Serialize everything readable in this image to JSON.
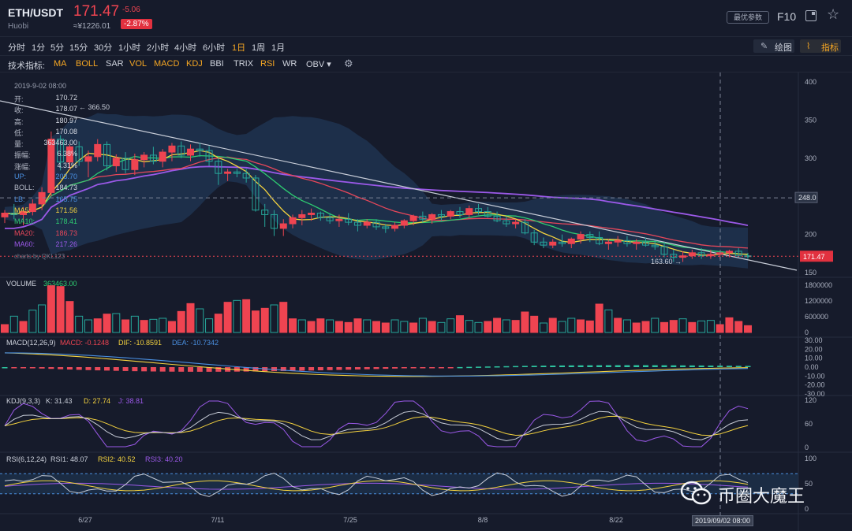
{
  "header": {
    "pair": "ETH/USDT",
    "exchange": "Huobi",
    "price": "171.47",
    "change": "-5.06",
    "cny_price": "≈¥1226.01",
    "change_pct": "-2.87%",
    "opt_button": "最优参数",
    "f10": "F10"
  },
  "timeframes": [
    "分时",
    "1分",
    "5分",
    "15分",
    "30分",
    "1小时",
    "2小时",
    "4小时",
    "6小时",
    "1日",
    "1周",
    "1月"
  ],
  "active_timeframe": "1日",
  "toolbar": {
    "draw_label": "绘图",
    "indicator_label": "指标"
  },
  "indicators": {
    "label": "技术指标:",
    "items": [
      {
        "name": "MA",
        "color": "#f5a623"
      },
      {
        "name": "BOLL",
        "color": "#f5a623"
      },
      {
        "name": "SAR",
        "color": "#d0d4de"
      },
      {
        "name": "VOL",
        "color": "#f5a623"
      },
      {
        "name": "MACD",
        "color": "#f5a623"
      },
      {
        "name": "KDJ",
        "color": "#f5a623"
      },
      {
        "name": "BBI",
        "color": "#d0d4de"
      },
      {
        "name": "TRIX",
        "color": "#d0d4de"
      },
      {
        "name": "RSI",
        "color": "#f5a623"
      },
      {
        "name": "WR",
        "color": "#d0d4de"
      },
      {
        "name": "OBV ▾",
        "color": "#d0d4de"
      }
    ]
  },
  "info_panel": {
    "date": "2019-9-02 08:00",
    "rows": [
      {
        "k": "开:",
        "v": "170.72",
        "kc": "#b6bbc8"
      },
      {
        "k": "收:",
        "v": "178.07",
        "kc": "#b6bbc8"
      },
      {
        "k": "高:",
        "v": "180.97",
        "kc": "#b6bbc8"
      },
      {
        "k": "低:",
        "v": "170.08",
        "kc": "#b6bbc8"
      },
      {
        "k": "量:",
        "v": "363463.00",
        "kc": "#b6bbc8"
      },
      {
        "k": "振幅:",
        "v": "6.38%",
        "kc": "#b6bbc8"
      },
      {
        "k": "涨幅:",
        "v": "4.31%",
        "kc": "#b6bbc8"
      },
      {
        "k": "UP:",
        "v": "203.70",
        "kc": "#4a90e2"
      },
      {
        "k": "BOLL:",
        "v": "184.73",
        "kc": "#b6bbc8"
      },
      {
        "k": "LB:",
        "v": "165.75",
        "kc": "#4a90e2"
      },
      {
        "k": "MA5:",
        "v": "171.56",
        "kc": "#f5d33f"
      },
      {
        "k": "MA10:",
        "v": "178.41",
        "kc": "#2ecc71"
      },
      {
        "k": "MA20:",
        "v": "186.73",
        "kc": "#e8475a"
      },
      {
        "k": "MA60:",
        "v": "217.26",
        "kc": "#9b59e8"
      }
    ],
    "credit": "charts by QKL123"
  },
  "price_axis": [
    "400",
    "350",
    "300",
    "250",
    "200",
    "150"
  ],
  "price_tags": {
    "current": "171.47",
    "cross": "248.0",
    "low": "163.60",
    "high": "366.50"
  },
  "volume": {
    "label": "VOLUME",
    "value": "363463.00",
    "axis": [
      "1800000",
      "1200000",
      "600000",
      "0"
    ]
  },
  "macd": {
    "label": "MACD(12,26,9)",
    "macd": "MACD: -0.1248",
    "dif": "DIF: -10.8591",
    "dea": "DEA: -10.7342",
    "axis": [
      "30.00",
      "20.00",
      "10.00",
      "0.00",
      "-10.00",
      "-20.00",
      "-30.00"
    ]
  },
  "kdj": {
    "label": "KDJ(9,3,3)",
    "k": "K: 31.43",
    "d": "D: 27.74",
    "j": "J: 38.81",
    "axis": [
      "120",
      "60",
      "0"
    ]
  },
  "rsi": {
    "label": "RSI(6,12,24)",
    "r1": "RSI1: 48.07",
    "r2": "RSI2: 40.52",
    "r3": "RSI3: 40.20",
    "axis": [
      "100",
      "50",
      "0"
    ]
  },
  "x_axis": [
    "6/27",
    "7/11",
    "7/25",
    "8/8",
    "8/22"
  ],
  "cross_date": "2019/09/02 08:00",
  "watermark": "币圈大魔王",
  "colors": {
    "up": "#ef4451",
    "down": "#26a69a",
    "ma5": "#f5d33f",
    "ma10": "#2ecc71",
    "ma20": "#e8475a",
    "ma60": "#9b59e8",
    "bg": "#161b2b"
  },
  "candles": [
    [
      223,
      232,
      215,
      228
    ],
    [
      228,
      240,
      220,
      226
    ],
    [
      226,
      236,
      212,
      230
    ],
    [
      230,
      246,
      225,
      240
    ],
    [
      240,
      262,
      232,
      255
    ],
    [
      255,
      335,
      250,
      325
    ],
    [
      325,
      330,
      284,
      295
    ],
    [
      295,
      318,
      285,
      315
    ],
    [
      315,
      322,
      290,
      296
    ],
    [
      296,
      310,
      275,
      302
    ],
    [
      302,
      325,
      296,
      318
    ],
    [
      318,
      322,
      284,
      290
    ],
    [
      290,
      305,
      282,
      300
    ],
    [
      300,
      308,
      280,
      285
    ],
    [
      285,
      306,
      278,
      298
    ],
    [
      298,
      308,
      288,
      304
    ],
    [
      304,
      315,
      292,
      296
    ],
    [
      296,
      312,
      288,
      308
    ],
    [
      308,
      320,
      296,
      316
    ],
    [
      316,
      322,
      300,
      304
    ],
    [
      304,
      318,
      296,
      312
    ],
    [
      312,
      320,
      302,
      310
    ],
    [
      310,
      316,
      290,
      296
    ],
    [
      296,
      300,
      265,
      280
    ],
    [
      280,
      286,
      270,
      282
    ],
    [
      282,
      286,
      275,
      280
    ],
    [
      280,
      286,
      268,
      274
    ],
    [
      274,
      278,
      230,
      232
    ],
    [
      232,
      240,
      210,
      226
    ],
    [
      226,
      232,
      198,
      208
    ],
    [
      208,
      220,
      198,
      214
    ],
    [
      214,
      226,
      208,
      222
    ],
    [
      222,
      232,
      212,
      226
    ],
    [
      226,
      234,
      218,
      228
    ],
    [
      228,
      230,
      218,
      222
    ],
    [
      222,
      228,
      214,
      218
    ],
    [
      218,
      226,
      210,
      220
    ],
    [
      220,
      228,
      212,
      216
    ],
    [
      216,
      220,
      204,
      212
    ],
    [
      212,
      220,
      208,
      216
    ],
    [
      216,
      220,
      206,
      210
    ],
    [
      210,
      214,
      202,
      208
    ],
    [
      208,
      216,
      204,
      212
    ],
    [
      212,
      220,
      208,
      218
    ],
    [
      218,
      226,
      212,
      224
    ],
    [
      224,
      230,
      216,
      220
    ],
    [
      220,
      228,
      214,
      226
    ],
    [
      226,
      232,
      218,
      224
    ],
    [
      224,
      232,
      220,
      230
    ],
    [
      230,
      236,
      222,
      226
    ],
    [
      226,
      238,
      222,
      234
    ],
    [
      234,
      240,
      226,
      230
    ],
    [
      230,
      236,
      222,
      224
    ],
    [
      224,
      230,
      216,
      218
    ],
    [
      218,
      224,
      210,
      214
    ],
    [
      214,
      220,
      208,
      216
    ],
    [
      216,
      220,
      200,
      202
    ],
    [
      202,
      206,
      186,
      190
    ],
    [
      190,
      196,
      182,
      186
    ],
    [
      186,
      194,
      182,
      190
    ],
    [
      190,
      200,
      184,
      188
    ],
    [
      188,
      196,
      182,
      194
    ],
    [
      194,
      204,
      188,
      200
    ],
    [
      200,
      204,
      190,
      196
    ],
    [
      196,
      204,
      186,
      188
    ],
    [
      188,
      194,
      180,
      190
    ],
    [
      190,
      198,
      184,
      192
    ],
    [
      192,
      198,
      184,
      188
    ],
    [
      188,
      194,
      180,
      190
    ],
    [
      190,
      196,
      184,
      186
    ],
    [
      186,
      192,
      180,
      184
    ],
    [
      184,
      190,
      170,
      174
    ],
    [
      174,
      180,
      164,
      170
    ],
    [
      170,
      178,
      164,
      172
    ],
    [
      172,
      180,
      168,
      176
    ],
    [
      176,
      182,
      168,
      172
    ],
    [
      172,
      180,
      168,
      174
    ],
    [
      174,
      178,
      168,
      176
    ],
    [
      176,
      180,
      170,
      178
    ],
    [
      178,
      182,
      170,
      172
    ],
    [
      172,
      176,
      168,
      171
    ]
  ],
  "volumes": [
    300000,
    620000,
    420000,
    850000,
    1050000,
    1780000,
    1750000,
    1180000,
    620000,
    480000,
    520000,
    700000,
    720000,
    480000,
    620000,
    460000,
    500000,
    540000,
    420000,
    800000,
    1100000,
    900000,
    520000,
    700000,
    1150000,
    1220000,
    1250000,
    820000,
    920000,
    1050000,
    1150000,
    520000,
    480000,
    420000,
    520000,
    480000,
    420000,
    380000,
    520000,
    480000,
    420000,
    360000,
    480000,
    420000,
    360000,
    540000,
    420000,
    380000,
    520000,
    640000,
    460000,
    380000,
    420000,
    540000,
    480000,
    460000,
    780000,
    620000,
    360000,
    540000,
    420000,
    540000,
    480000,
    440000,
    1080000,
    860000,
    540000,
    480000,
    360000,
    420000,
    540000,
    380000,
    460000,
    520000,
    380000,
    440000,
    460000,
    300000,
    560000,
    420000,
    260000
  ],
  "volume_up_flags": [
    1,
    0,
    1,
    0,
    0,
    1,
    1,
    1,
    0,
    0,
    1,
    1,
    0,
    1,
    0,
    1,
    0,
    0,
    1,
    1,
    1,
    0,
    0,
    1,
    1,
    0,
    1,
    1,
    1,
    0,
    1,
    1,
    0,
    1,
    1,
    0,
    1,
    1,
    1,
    0,
    1,
    1,
    0,
    0,
    1,
    0,
    1,
    0,
    0,
    1,
    0,
    0,
    1,
    1,
    0,
    1,
    1,
    1,
    0,
    1,
    0,
    0,
    1,
    1,
    1,
    0,
    1,
    0,
    1,
    1,
    0,
    1,
    1,
    0,
    1,
    0,
    0,
    1,
    1,
    1,
    1
  ]
}
